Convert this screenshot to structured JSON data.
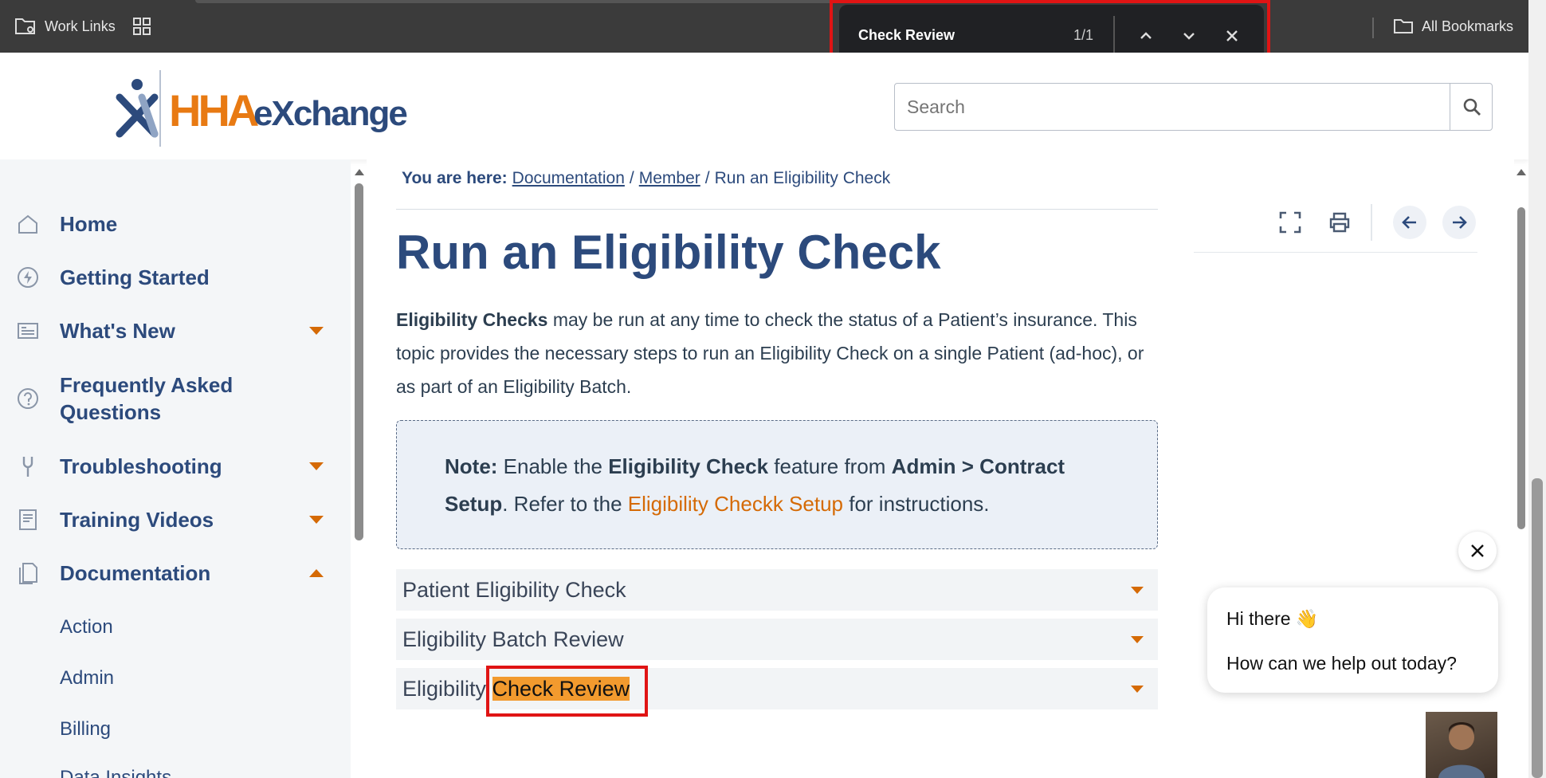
{
  "browser": {
    "bookmarks": [
      {
        "label": "Work Links",
        "icon": "folder-gear-icon"
      },
      {
        "label": "",
        "icon": "apps-grid-icon"
      }
    ],
    "all_bookmarks": "All Bookmarks",
    "find": {
      "query": "Check Review",
      "count": "1/1"
    }
  },
  "site": {
    "logo": {
      "brand": "HHA",
      "suffix": "eXchange"
    },
    "search_placeholder": "Search"
  },
  "sidebar": {
    "items": [
      {
        "label": "Home",
        "icon": "home-icon"
      },
      {
        "label": "Getting Started",
        "icon": "bolt-icon"
      },
      {
        "label": "What's New",
        "icon": "newspaper-icon"
      },
      {
        "label": "Frequently Asked",
        "label2": "Questions",
        "icon": "question-icon"
      },
      {
        "label": "Troubleshooting",
        "icon": "wrench-icon"
      },
      {
        "label": "Training Videos",
        "icon": "book-icon"
      },
      {
        "label": "Documentation",
        "icon": "document-icon"
      }
    ],
    "sub_items": [
      "Action",
      "Admin",
      "Billing",
      "Data Insights"
    ]
  },
  "breadcrumb": {
    "prefix": "You are here:",
    "items": [
      "Documentation",
      "Member"
    ],
    "current": "Run an Eligibility Check"
  },
  "article": {
    "title": "Run an Eligibility Check",
    "intro_bold": "Eligibility Checks",
    "intro_line1": " may be run at any time to check the status of a Patient’s insurance. This",
    "intro_line2": "topic provides the necessary steps to run an Eligibility Check on a single Patient (ad-hoc), or",
    "intro_line3": "as part of an Eligibility Batch.",
    "note": {
      "label": "Note:",
      "t1": " Enable the ",
      "b1": "Eligibility Check",
      "t2": " feature from ",
      "b2": "Admin > Contract",
      "b3": "Setup",
      "t3": ". Refer to the ",
      "link": "Eligibility Checkk Setup",
      "t4": " for instructions."
    },
    "accordions": [
      {
        "label": "Patient Eligibility Check"
      },
      {
        "label": "Eligibility Batch Review"
      },
      {
        "label_prefix": "Eligibility ",
        "label_match": "Check Review"
      }
    ]
  },
  "chat": {
    "greeting": "Hi there 👋",
    "question": "How can we help out today?"
  },
  "colors": {
    "accent": "#d56a05",
    "navy": "#2c4a7c",
    "highlight": "#f29a2e",
    "frame": "#e01414"
  }
}
